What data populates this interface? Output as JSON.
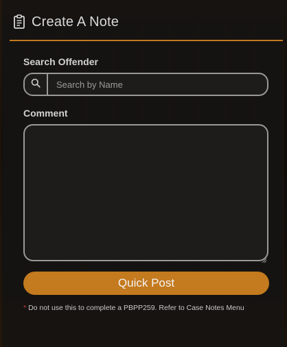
{
  "header": {
    "title": "Create A Note",
    "icon": "clipboard-icon",
    "accent_color": "#c47a1e"
  },
  "search": {
    "label": "Search Offender",
    "placeholder": "Search by Name",
    "value": "",
    "icon": "search-icon"
  },
  "comment": {
    "label": "Comment",
    "value": ""
  },
  "actions": {
    "quick_post_label": "Quick Post"
  },
  "footer": {
    "required_mark": "*",
    "note": "Do not use this to complete a PBPP259. Refer to Case Notes Menu"
  }
}
